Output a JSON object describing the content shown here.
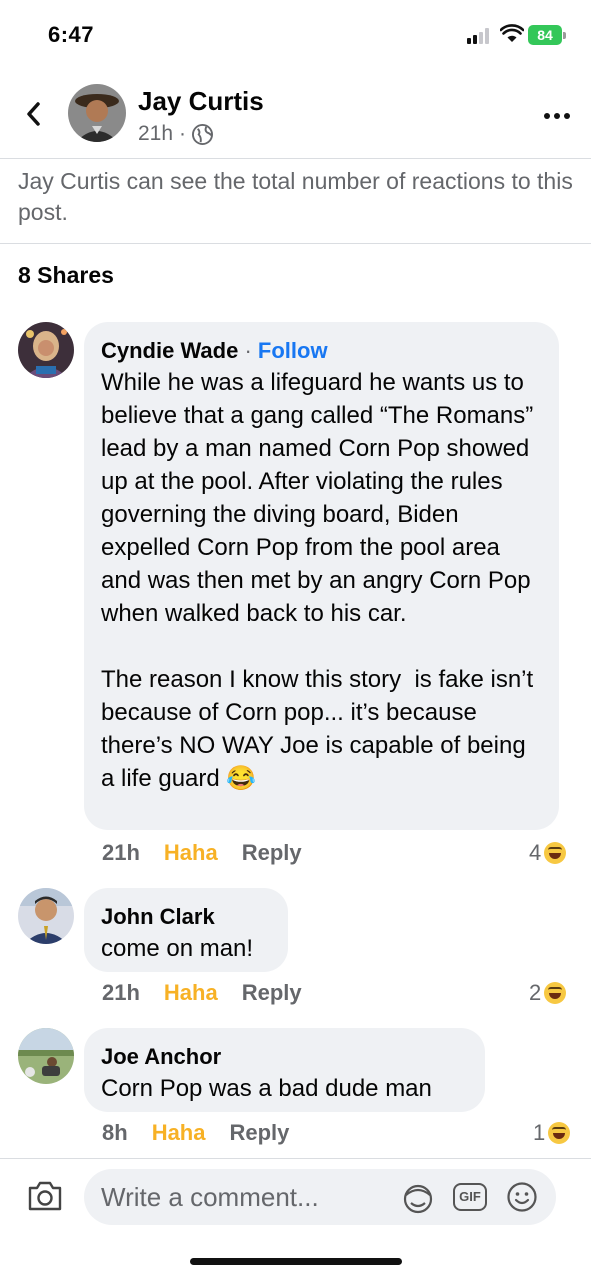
{
  "status_bar": {
    "time": "6:47",
    "battery": "84"
  },
  "header": {
    "name": "Jay Curtis",
    "time": "21h",
    "meta_separator": "·"
  },
  "notice": "Jay Curtis can see the total number of reactions to this post.",
  "shares": "8 Shares",
  "comments": [
    {
      "author": "Cyndie Wade",
      "separator": "·",
      "follow": "Follow",
      "text": "While he was a lifeguard he wants us to believe that a gang called “The Romans” lead by a man named Corn Pop showed up at the pool. After violating the rules governing the diving board, Biden expelled Corn Pop from the pool area and was then met by an angry Corn Pop when walked back to his car.\n\nThe reason I know this story  is fake isn’t because of Corn pop... it’s because there’s NO WAY Joe is capable of being a life guard",
      "emoji": "😂",
      "time": "21h",
      "reaction_label": "Haha",
      "reply_label": "Reply",
      "reaction_count": "4"
    },
    {
      "author": "John Clark",
      "text": "come on man!",
      "time": "21h",
      "reaction_label": "Haha",
      "reply_label": "Reply",
      "reaction_count": "2"
    },
    {
      "author": "Joe Anchor",
      "text": "Corn Pop was a bad dude man",
      "time": "8h",
      "reaction_label": "Haha",
      "reply_label": "Reply",
      "reaction_count": "1"
    }
  ],
  "composer": {
    "placeholder": "Write a comment...",
    "gif_label": "GIF"
  },
  "colors": {
    "accent": "#1877f2",
    "haha": "#f7b125",
    "bubble": "#eff1f4",
    "secondary_text": "#65676b"
  }
}
